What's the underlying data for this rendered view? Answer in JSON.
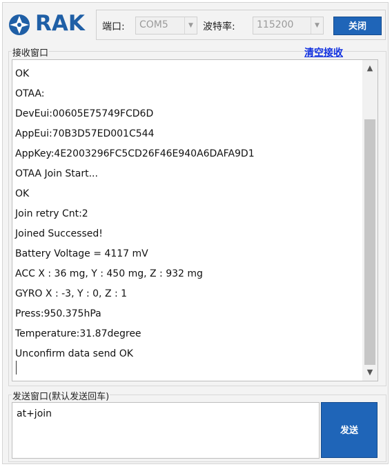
{
  "header": {
    "logo_text": "RAK",
    "port_label": "端口:",
    "port_value": "COM5",
    "baud_label": "波特率:",
    "baud_value": "115200",
    "close_label": "关闭",
    "brand_color": "#1f5fa6"
  },
  "receive": {
    "label": "接收窗口",
    "clear_label": "清空接收",
    "lines": [
      "OK",
      "OTAA:",
      "DevEui:00605E75749FCD6D",
      "AppEui:70B3D57ED001C544",
      "AppKey:4E2003296FC5CD26F46E940A6DAFA9D1",
      "OTAA Join Start...",
      "OK",
      "Join retry Cnt:2",
      "Joined Successed!",
      "Battery Voltage = 4117 mV",
      "ACC X : 36 mg, Y : 450 mg, Z : 932 mg",
      "GYRO X : -3, Y : 0, Z : 1",
      "Press:950.375hPa",
      "Temperature:31.87degree",
      "Unconfirm data send OK"
    ]
  },
  "send": {
    "label": "发送窗口(默认发送回车)",
    "input_value": "at+join",
    "send_label": "发送",
    "button_color": "#1f65b8"
  },
  "icons": {
    "logo": "rak-logo-icon",
    "dropdown": "chevron-down-icon",
    "scroll_up": "chevron-up-icon",
    "scroll_down": "chevron-down-icon"
  }
}
